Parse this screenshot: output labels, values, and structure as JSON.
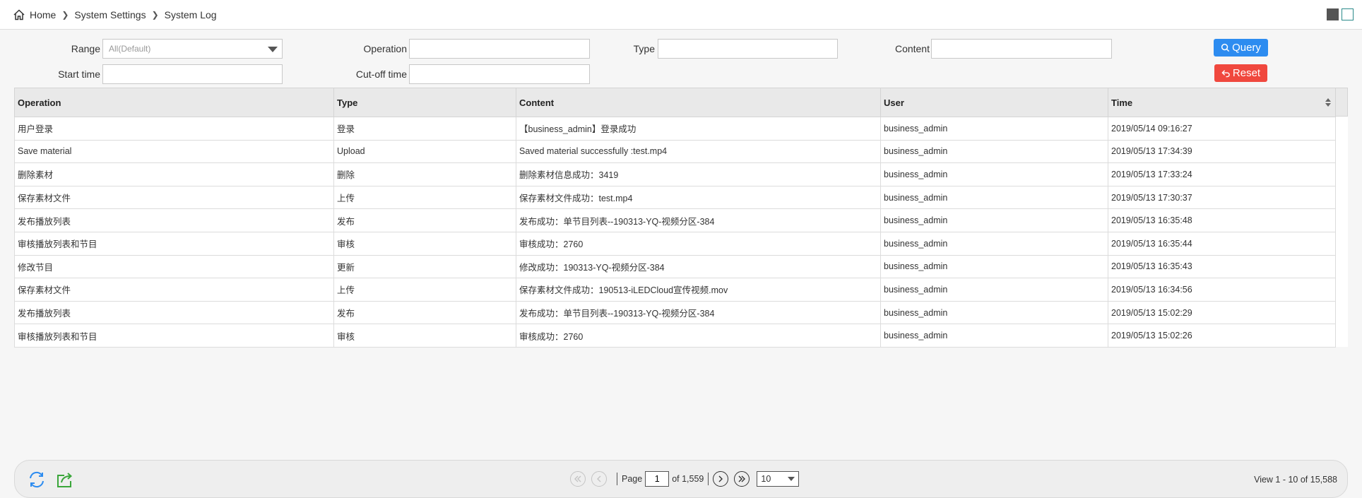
{
  "breadcrumb": {
    "home": "Home",
    "level1": "System Settings",
    "level2": "System Log"
  },
  "filters": {
    "range_label": "Range",
    "range_value": "All(Default)",
    "operation_label": "Operation",
    "operation_value": "",
    "type_label": "Type",
    "type_value": "",
    "content_label": "Content",
    "content_value": "",
    "start_time_label": "Start time",
    "start_time_value": "",
    "cutoff_time_label": "Cut-off time",
    "cutoff_time_value": "",
    "query_label": "Query",
    "reset_label": "Reset"
  },
  "table": {
    "columns": [
      "Operation",
      "Type",
      "Content",
      "User",
      "Time"
    ],
    "rows": [
      [
        "用户登录",
        "登录",
        "【business_admin】登录成功",
        "business_admin",
        "2019/05/14 09:16:27"
      ],
      [
        "Save material",
        "Upload",
        "Saved material successfully :test.mp4",
        "business_admin",
        "2019/05/13 17:34:39"
      ],
      [
        "删除素材",
        "删除",
        "删除素材信息成功：3419",
        "business_admin",
        "2019/05/13 17:33:24"
      ],
      [
        "保存素材文件",
        "上传",
        "保存素材文件成功：test.mp4",
        "business_admin",
        "2019/05/13 17:30:37"
      ],
      [
        "发布播放列表",
        "发布",
        "发布成功：单节目列表--190313-YQ-视频分区-384",
        "business_admin",
        "2019/05/13 16:35:48"
      ],
      [
        "审核播放列表和节目",
        "审核",
        "审核成功：2760",
        "business_admin",
        "2019/05/13 16:35:44"
      ],
      [
        "修改节目",
        "更新",
        "修改成功：190313-YQ-视频分区-384",
        "business_admin",
        "2019/05/13 16:35:43"
      ],
      [
        "保存素材文件",
        "上传",
        "保存素材文件成功：190513-iLEDCloud宣传视频.mov",
        "business_admin",
        "2019/05/13 16:34:56"
      ],
      [
        "发布播放列表",
        "发布",
        "发布成功：单节目列表--190313-YQ-视频分区-384",
        "business_admin",
        "2019/05/13 15:02:29"
      ],
      [
        "审核播放列表和节目",
        "审核",
        "审核成功：2760",
        "business_admin",
        "2019/05/13 15:02:26"
      ]
    ]
  },
  "pager": {
    "page_label": "Page",
    "current_page": "1",
    "of_pages": "of 1,559",
    "rows_per_page": "10",
    "view_info": "View 1 - 10 of 15,588"
  },
  "colors": {
    "query_button": "#2d8cf0",
    "reset_button": "#f0483e",
    "refresh_icon": "#2d8cf0",
    "export_icon": "#3aa63a"
  },
  "icons": {
    "home": "home-icon",
    "refresh": "refresh-icon",
    "export": "export-icon",
    "search": "search-icon",
    "reset": "reset-icon"
  }
}
